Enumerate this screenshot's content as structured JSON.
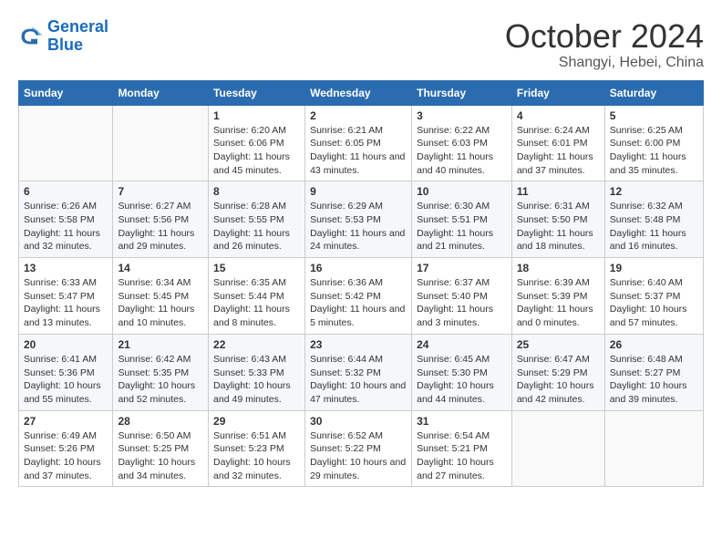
{
  "header": {
    "logo_line1": "General",
    "logo_line2": "Blue",
    "month": "October 2024",
    "location": "Shangyi, Hebei, China"
  },
  "weekdays": [
    "Sunday",
    "Monday",
    "Tuesday",
    "Wednesday",
    "Thursday",
    "Friday",
    "Saturday"
  ],
  "weeks": [
    [
      {
        "day": "",
        "info": ""
      },
      {
        "day": "",
        "info": ""
      },
      {
        "day": "1",
        "info": "Sunrise: 6:20 AM\nSunset: 6:06 PM\nDaylight: 11 hours and 45 minutes."
      },
      {
        "day": "2",
        "info": "Sunrise: 6:21 AM\nSunset: 6:05 PM\nDaylight: 11 hours and 43 minutes."
      },
      {
        "day": "3",
        "info": "Sunrise: 6:22 AM\nSunset: 6:03 PM\nDaylight: 11 hours and 40 minutes."
      },
      {
        "day": "4",
        "info": "Sunrise: 6:24 AM\nSunset: 6:01 PM\nDaylight: 11 hours and 37 minutes."
      },
      {
        "day": "5",
        "info": "Sunrise: 6:25 AM\nSunset: 6:00 PM\nDaylight: 11 hours and 35 minutes."
      }
    ],
    [
      {
        "day": "6",
        "info": "Sunrise: 6:26 AM\nSunset: 5:58 PM\nDaylight: 11 hours and 32 minutes."
      },
      {
        "day": "7",
        "info": "Sunrise: 6:27 AM\nSunset: 5:56 PM\nDaylight: 11 hours and 29 minutes."
      },
      {
        "day": "8",
        "info": "Sunrise: 6:28 AM\nSunset: 5:55 PM\nDaylight: 11 hours and 26 minutes."
      },
      {
        "day": "9",
        "info": "Sunrise: 6:29 AM\nSunset: 5:53 PM\nDaylight: 11 hours and 24 minutes."
      },
      {
        "day": "10",
        "info": "Sunrise: 6:30 AM\nSunset: 5:51 PM\nDaylight: 11 hours and 21 minutes."
      },
      {
        "day": "11",
        "info": "Sunrise: 6:31 AM\nSunset: 5:50 PM\nDaylight: 11 hours and 18 minutes."
      },
      {
        "day": "12",
        "info": "Sunrise: 6:32 AM\nSunset: 5:48 PM\nDaylight: 11 hours and 16 minutes."
      }
    ],
    [
      {
        "day": "13",
        "info": "Sunrise: 6:33 AM\nSunset: 5:47 PM\nDaylight: 11 hours and 13 minutes."
      },
      {
        "day": "14",
        "info": "Sunrise: 6:34 AM\nSunset: 5:45 PM\nDaylight: 11 hours and 10 minutes."
      },
      {
        "day": "15",
        "info": "Sunrise: 6:35 AM\nSunset: 5:44 PM\nDaylight: 11 hours and 8 minutes."
      },
      {
        "day": "16",
        "info": "Sunrise: 6:36 AM\nSunset: 5:42 PM\nDaylight: 11 hours and 5 minutes."
      },
      {
        "day": "17",
        "info": "Sunrise: 6:37 AM\nSunset: 5:40 PM\nDaylight: 11 hours and 3 minutes."
      },
      {
        "day": "18",
        "info": "Sunrise: 6:39 AM\nSunset: 5:39 PM\nDaylight: 11 hours and 0 minutes."
      },
      {
        "day": "19",
        "info": "Sunrise: 6:40 AM\nSunset: 5:37 PM\nDaylight: 10 hours and 57 minutes."
      }
    ],
    [
      {
        "day": "20",
        "info": "Sunrise: 6:41 AM\nSunset: 5:36 PM\nDaylight: 10 hours and 55 minutes."
      },
      {
        "day": "21",
        "info": "Sunrise: 6:42 AM\nSunset: 5:35 PM\nDaylight: 10 hours and 52 minutes."
      },
      {
        "day": "22",
        "info": "Sunrise: 6:43 AM\nSunset: 5:33 PM\nDaylight: 10 hours and 49 minutes."
      },
      {
        "day": "23",
        "info": "Sunrise: 6:44 AM\nSunset: 5:32 PM\nDaylight: 10 hours and 47 minutes."
      },
      {
        "day": "24",
        "info": "Sunrise: 6:45 AM\nSunset: 5:30 PM\nDaylight: 10 hours and 44 minutes."
      },
      {
        "day": "25",
        "info": "Sunrise: 6:47 AM\nSunset: 5:29 PM\nDaylight: 10 hours and 42 minutes."
      },
      {
        "day": "26",
        "info": "Sunrise: 6:48 AM\nSunset: 5:27 PM\nDaylight: 10 hours and 39 minutes."
      }
    ],
    [
      {
        "day": "27",
        "info": "Sunrise: 6:49 AM\nSunset: 5:26 PM\nDaylight: 10 hours and 37 minutes."
      },
      {
        "day": "28",
        "info": "Sunrise: 6:50 AM\nSunset: 5:25 PM\nDaylight: 10 hours and 34 minutes."
      },
      {
        "day": "29",
        "info": "Sunrise: 6:51 AM\nSunset: 5:23 PM\nDaylight: 10 hours and 32 minutes."
      },
      {
        "day": "30",
        "info": "Sunrise: 6:52 AM\nSunset: 5:22 PM\nDaylight: 10 hours and 29 minutes."
      },
      {
        "day": "31",
        "info": "Sunrise: 6:54 AM\nSunset: 5:21 PM\nDaylight: 10 hours and 27 minutes."
      },
      {
        "day": "",
        "info": ""
      },
      {
        "day": "",
        "info": ""
      }
    ]
  ]
}
